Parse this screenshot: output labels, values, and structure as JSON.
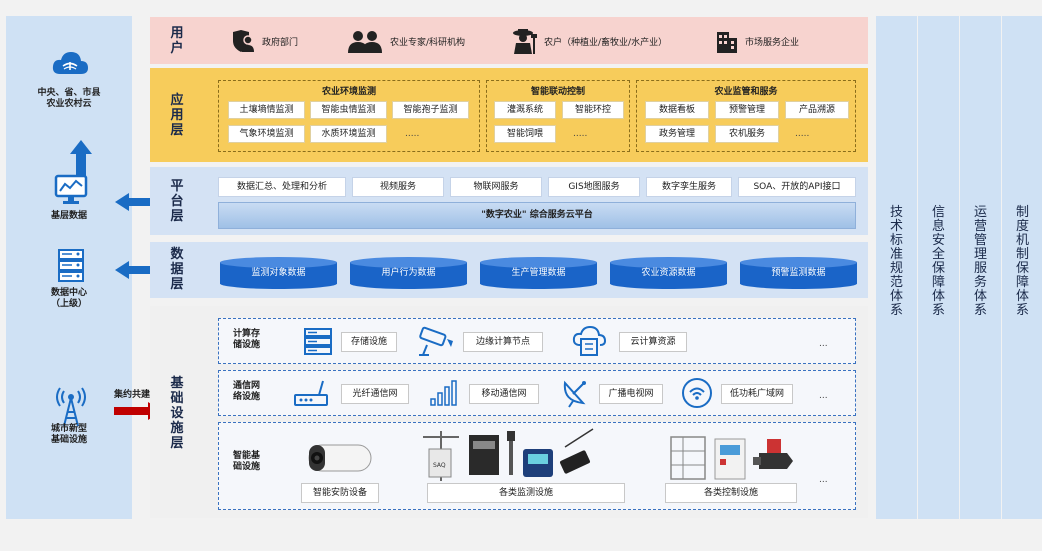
{
  "left": {
    "cloud_label": "中央、省、市县\n农业农村云",
    "base_data_label": "基层数据",
    "data_center_label": "数据中心\n（上级）",
    "city_infra_label": "城市新型\n基础设施",
    "intensive_label": "集约共建"
  },
  "user_layer": {
    "title": "用户",
    "items": [
      {
        "label": "政府部门",
        "icon": "government-shield-icon"
      },
      {
        "label": "农业专家/科研机构",
        "icon": "experts-icon"
      },
      {
        "label": "农户（种植业/畜牧业/水产业）",
        "icon": "farmer-icon"
      },
      {
        "label": "市场服务企业",
        "icon": "enterprise-building-icon"
      }
    ]
  },
  "app_layer": {
    "title": "应用层",
    "groups": [
      {
        "title": "农业环境监测",
        "items": [
          "土壤墒情监测",
          "智能虫情监测",
          "智能孢子监测",
          "气象环境监测",
          "水质环境监测",
          "....."
        ]
      },
      {
        "title": "智能联动控制",
        "items": [
          "灌溉系统",
          "智能环控",
          "智能饲喂",
          "....."
        ]
      },
      {
        "title": "农业监管和服务",
        "items": [
          "数据看板",
          "预警管理",
          "产品溯源",
          "政务管理",
          "农机服务",
          "....."
        ]
      }
    ]
  },
  "platform_layer": {
    "title": "平台层",
    "services": [
      "数据汇总、处理和分析",
      "视频服务",
      "物联网服务",
      "GIS地图服务",
      "数字孪生服务",
      "SOA、开放的API接口"
    ],
    "platform_name": "\"数字农业\" 综合服务云平台"
  },
  "data_layer": {
    "title": "数据层",
    "stores": [
      "监测对象数据",
      "用户行为数据",
      "生产管理数据",
      "农业资源数据",
      "预警监测数据"
    ]
  },
  "infra_layer": {
    "title": "基础设施层",
    "rows": [
      {
        "title": "计算存\n储设施",
        "items": [
          "存储设施",
          "边缘计算节点",
          "云计算资源"
        ],
        "more": "...",
        "icons": [
          "server-rack-icon",
          "camera-icon",
          "cloud-compute-icon"
        ]
      },
      {
        "title": "通信网\n络设施",
        "items": [
          "光纤通信网",
          "移动通信网",
          "广播电视网",
          "低功耗广域网"
        ],
        "more": "...",
        "icons": [
          "router-icon",
          "signal-bars-icon",
          "satellite-dish-icon",
          "wireless-icon"
        ]
      },
      {
        "title": "智能基\n础设施",
        "items": [
          "智能安防设备",
          "各类监测设施",
          "各类控制设施"
        ],
        "more": "..."
      }
    ]
  },
  "side_columns": [
    "技术标准规范体系",
    "信息安全保障体系",
    "运营管理服务体系",
    "制度机制保障体系"
  ],
  "colors": {
    "user": "#f7d3cf",
    "app": "#f7cc5b",
    "platform": "#d4e2f4",
    "accent_blue": "#1a64c8",
    "red_arrow": "#c00000"
  }
}
